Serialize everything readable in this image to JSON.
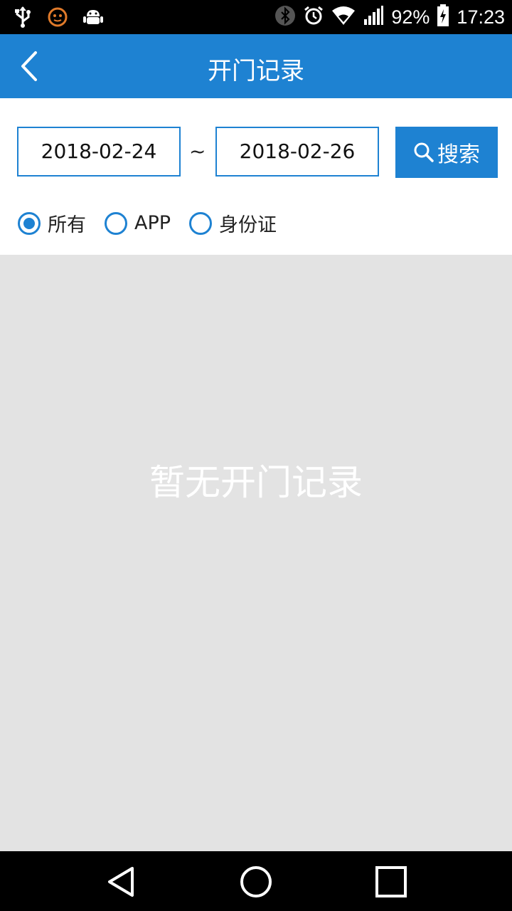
{
  "status_bar": {
    "battery_percent": "92%",
    "time": "17:23",
    "left_icons": [
      "usb-icon",
      "face-icon",
      "android-debug-icon"
    ],
    "right_icons": [
      "bluetooth-icon",
      "alarm-icon",
      "wifi-icon",
      "signal-icon",
      "battery-charging-icon"
    ]
  },
  "app_bar": {
    "title": "开门记录",
    "back_icon": "chevron-left-icon"
  },
  "filter": {
    "start_date": "2018-02-24",
    "separator": "~",
    "end_date": "2018-02-26",
    "search_label": "搜索",
    "options": [
      {
        "label": "所有",
        "checked": true
      },
      {
        "label": "APP",
        "checked": false
      },
      {
        "label": "身份证",
        "checked": false
      }
    ]
  },
  "content": {
    "empty_message": "暂无开门记录"
  },
  "nav_bar": {
    "buttons": [
      "back-triangle-icon",
      "home-circle-icon",
      "recents-square-icon"
    ]
  },
  "colors": {
    "primary": "#1e82d2",
    "background": "#e3e3e3",
    "empty_text": "#ffffff"
  }
}
